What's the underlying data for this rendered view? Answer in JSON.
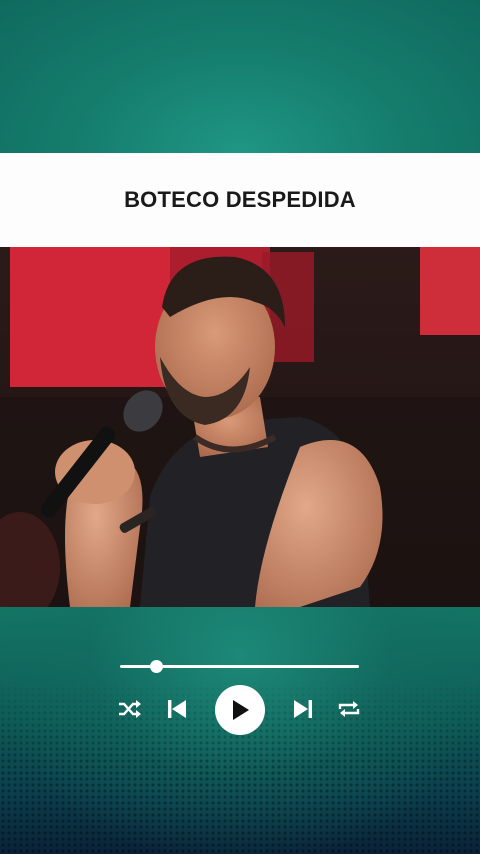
{
  "title": "BOTECO DESPEDIDA",
  "player": {
    "progress": 0.15
  },
  "icons": {
    "shuffle": "shuffle-icon",
    "previous": "skip-previous-icon",
    "play": "play-icon",
    "next": "skip-next-icon",
    "repeat": "repeat-icon"
  },
  "colors": {
    "background": "#157565",
    "title_bar": "#fdfdfd",
    "title_text": "#1a1a1a",
    "controls": "#ffffff"
  }
}
